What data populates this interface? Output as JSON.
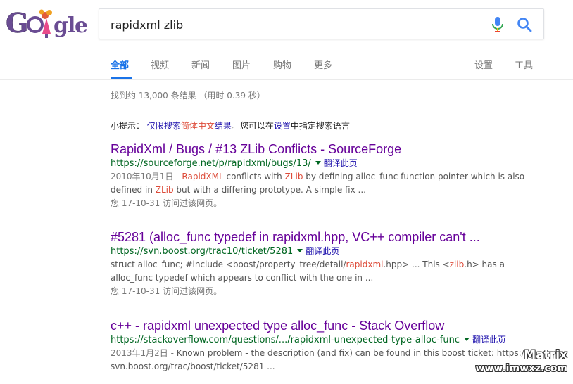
{
  "logo": {
    "alt": "Google doodle logo"
  },
  "search": {
    "query": "rapidxml zlib"
  },
  "tabs": [
    {
      "label": "全部",
      "active": true
    },
    {
      "label": "视频"
    },
    {
      "label": "新闻"
    },
    {
      "label": "图片"
    },
    {
      "label": "购物"
    },
    {
      "label": "更多"
    }
  ],
  "tools": {
    "settings": "设置",
    "tools": "工具"
  },
  "stats": "找到约 13,000 条结果 （用时 0.39 秒）",
  "hint": {
    "prefix": "小提示：",
    "link_a": "仅限搜索",
    "lang": "简体中文",
    "link_b": "结果",
    "middle": "。您可以在",
    "settings_link": "设置",
    "suffix": "中指定搜索语言"
  },
  "results": [
    {
      "title": "RapidXml / Bugs / #13 ZLib Conflicts - SourceForge",
      "url": "https://sourceforge.net/p/rapidxml/bugs/13/",
      "translate": "翻译此页",
      "date": "2010年10月1日 - ",
      "snippet_1a": "RapidXML",
      "snippet_1b": " conflicts with ",
      "snippet_1c": "ZLib",
      "snippet_1d": " by defining alloc_func function pointer which is also defined in ",
      "snippet_1e": "ZLib",
      "snippet_1f": " but with a differing prototype. A simple fix ...",
      "visited": "您 17-10-31 访问过该网页。"
    },
    {
      "title": "#5281 (alloc_func typedef in rapidxml.hpp, VC++ compiler can't ...",
      "url": "https://svn.boost.org/trac10/ticket/5281",
      "translate": "翻译此页",
      "snippet_2a": "struct alloc_func; #include <boost/property_tree/detail/",
      "snippet_2b": "rapidxml",
      "snippet_2c": ".hpp> ... This <",
      "snippet_2d": "zlib",
      "snippet_2e": ".h> has a alloc_func typedef which appears to conflict with the one in ...",
      "visited": "您 17-10-31 访问过该网页。"
    },
    {
      "title": "c++ - rapidxml unexpected type alloc_func - Stack Overflow",
      "url": "https://stackoverflow.com/questions/.../rapidxml-unexpected-type-alloc-func",
      "translate": "翻译此页",
      "date": "2013年1月2日 - ",
      "snippet_3": "Known problem - the description (and fix) can be found in this boost ticket: https:// svn.boost.org/trac/boost/ticket/5281 ..."
    }
  ],
  "watermark": {
    "line1": "Matrix",
    "line2": "www.imwxz.com"
  },
  "colors": {
    "accent": "#1a73e8",
    "visited_title": "#660099",
    "url_green": "#006621",
    "highlight_red": "#dd4b39"
  }
}
